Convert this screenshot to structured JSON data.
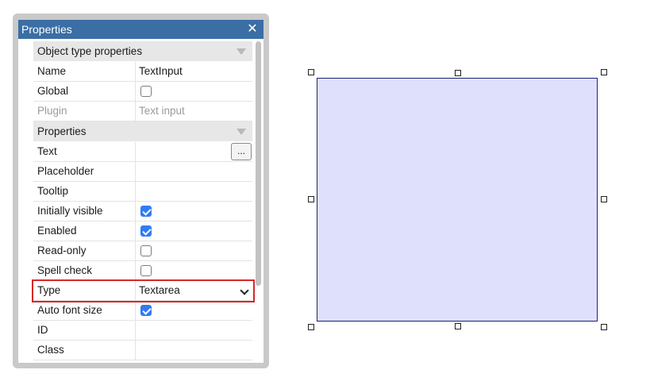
{
  "panel": {
    "title": "Properties",
    "close_icon": "close-icon"
  },
  "sections": {
    "object_type": "Object type properties",
    "properties": "Properties"
  },
  "object_type_rows": {
    "name_label": "Name",
    "name_value": "TextInput",
    "global_label": "Global",
    "global_checked": false,
    "plugin_label": "Plugin",
    "plugin_value": "Text input"
  },
  "property_rows": {
    "text_label": "Text",
    "text_value": "",
    "text_button": "...",
    "placeholder_label": "Placeholder",
    "placeholder_value": "",
    "tooltip_label": "Tooltip",
    "tooltip_value": "",
    "initially_visible_label": "Initially visible",
    "initially_visible_checked": true,
    "enabled_label": "Enabled",
    "enabled_checked": true,
    "readonly_label": "Read-only",
    "readonly_checked": false,
    "spellcheck_label": "Spell check",
    "spellcheck_checked": false,
    "type_label": "Type",
    "type_value": "Textarea",
    "auto_font_label": "Auto font size",
    "auto_font_checked": true,
    "id_label": "ID",
    "id_value": "",
    "class_label": "Class",
    "class_value": ""
  },
  "colors": {
    "titlebar": "#3a6ea5",
    "highlight": "#d62828",
    "checkbox_checked": "#2f7cf6",
    "shape_fill": "#dfe0fc",
    "shape_border": "#1a2470"
  }
}
